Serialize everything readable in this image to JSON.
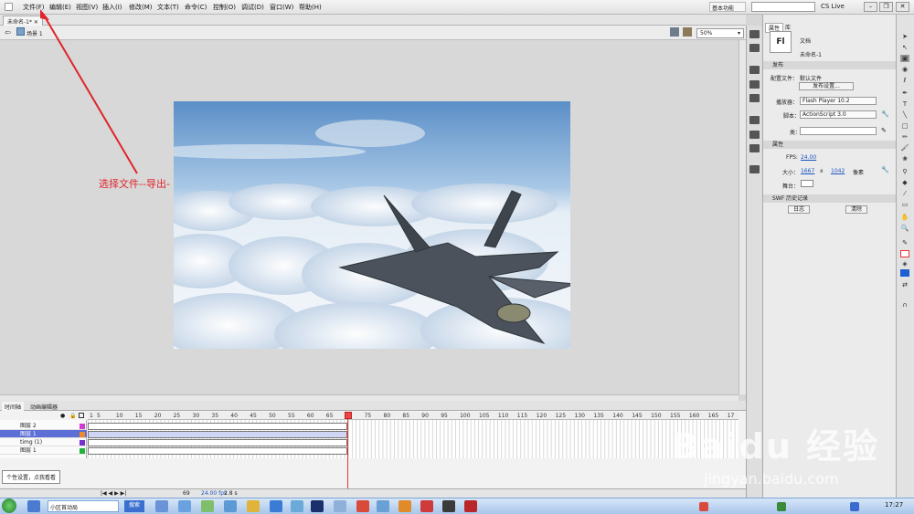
{
  "menubar": {
    "items": [
      "文件(F)",
      "编辑(E)",
      "视图(V)",
      "插入(I)",
      "修改(M)",
      "文本(T)",
      "命令(C)",
      "控制(O)",
      "调试(D)",
      "窗口(W)",
      "帮助(H)"
    ],
    "workspace": "基本功能",
    "cs_live": "CS Live"
  },
  "document": {
    "tab_label": "未命名-1*",
    "scene_label": "场景 1",
    "zoom": "50%"
  },
  "annotation": {
    "text": "选择文件--导出-"
  },
  "timeline": {
    "tabs": [
      "时间轴",
      "动画编辑器"
    ],
    "ruler_ticks": [
      "1",
      "5",
      "10",
      "15",
      "20",
      "25",
      "30",
      "35",
      "40",
      "45",
      "50",
      "55",
      "60",
      "65",
      "70",
      "75",
      "80",
      "85",
      "90",
      "95",
      "100",
      "105",
      "110",
      "115",
      "120",
      "125",
      "130",
      "135",
      "140",
      "145",
      "150",
      "155",
      "160",
      "165",
      "17"
    ],
    "layers": [
      {
        "name": "图层 2",
        "color": "#d33cd3"
      },
      {
        "name": "图层 1",
        "color": "#ee8a2a"
      },
      {
        "name": "timg (1)",
        "color": "#7a2fd0"
      },
      {
        "name": "图层 1",
        "color": "#22b33a"
      }
    ],
    "current_frame": "69",
    "fps": "24.00 fps",
    "elapsed": "2.8 s",
    "tooltip": "个性设置，点我看看"
  },
  "properties": {
    "tabs": [
      "属性",
      "库"
    ],
    "doc_type": "文档",
    "doc_name": "未命名-1",
    "logo": "Fl",
    "publish_header": "发布",
    "profile_label": "配置文件：",
    "profile_value": "默认文件",
    "publish_settings": "发布设置...",
    "player_label": "播放器：",
    "player_value": "Flash Player 10.2",
    "script_label": "脚本：",
    "script_value": "ActionScript 3.0",
    "class_label": "类：",
    "props_header": "属性",
    "fps_label": "FPS:",
    "fps_value": "24.00",
    "size_label": "大小：",
    "width": "1667",
    "x_sep": "x",
    "height": "1042",
    "unit": "像素",
    "stage_label": "舞台：",
    "swf_header": "SWF 历史记录",
    "log_button": "日志",
    "clear_button": "清除"
  },
  "taskbar": {
    "search_label": "搜索",
    "ie_label": "小区首动局",
    "time": "17:27"
  },
  "watermark": {
    "brand": "Baidu 经验",
    "url": "jingyan.baidu.com"
  },
  "colors": {
    "annotation_red": "#e0242b",
    "selected_layer": "#5b6fd6",
    "playhead": "#e33333"
  }
}
